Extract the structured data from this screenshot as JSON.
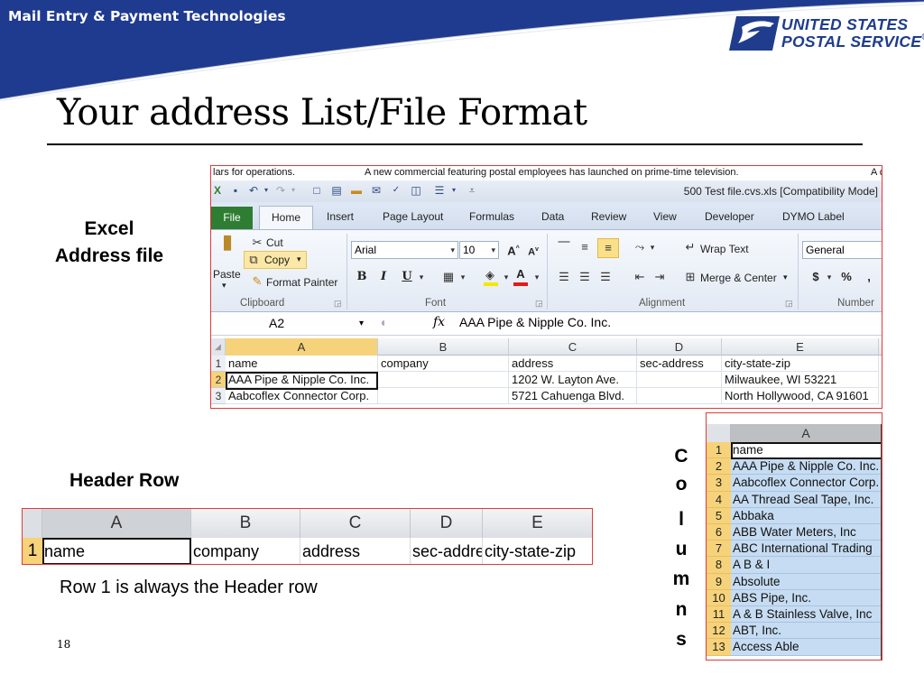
{
  "header": {
    "label": "Mail Entry & Payment Technologies",
    "logo_line1": "UNITED STATES",
    "logo_line2": "POSTAL SERVICE",
    "logo_mark": "®",
    "band_color": "#1f3b8f"
  },
  "slide": {
    "title": "Your address List/File Format",
    "page_number": "18"
  },
  "labels": {
    "excel_line1": "Excel",
    "excel_line2": "Address file",
    "header_row": "Header Row",
    "row1_caption": "Row 1 is always the Header row",
    "columns_letters": [
      "C",
      "o",
      "l",
      "u",
      "m",
      "n",
      "s"
    ]
  },
  "excel": {
    "ticker_left": "lars for operations.",
    "ticker_mid": "A new commercial featuring postal employees has launched on prime-time television.",
    "ticker_right": "A c",
    "window_title": "500 Test file.cvs.xls  [Compatibility Mode]",
    "tabs": [
      "File",
      "Home",
      "Insert",
      "Page Layout",
      "Formulas",
      "Data",
      "Review",
      "View",
      "Developer",
      "DYMO Label"
    ],
    "ribbon": {
      "paste": "Paste",
      "cut": "Cut",
      "copy": "Copy",
      "format_painter": "Format Painter",
      "font_name": "Arial",
      "font_size": "10",
      "wrap_text": "Wrap Text",
      "merge_center": "Merge & Center",
      "number_format": "General",
      "groups": [
        "Clipboard",
        "Font",
        "Alignment",
        "Number"
      ]
    },
    "name_box": "A2",
    "formula": "AAA Pipe & Nipple Co. Inc.",
    "columns": [
      "A",
      "B",
      "C",
      "D",
      "E"
    ],
    "rows": [
      {
        "num": "1",
        "cells": [
          "name",
          "company",
          "address",
          "sec-address",
          "city-state-zip"
        ]
      },
      {
        "num": "2",
        "cells": [
          "AAA Pipe & Nipple Co. Inc.",
          "",
          "1202 W. Layton Ave.",
          "",
          "Milwaukee, WI 53221"
        ]
      },
      {
        "num": "3",
        "cells": [
          "Aabcoflex Connector Corp.",
          "",
          "5721 Cahuenga Blvd.",
          "",
          "North Hollywood, CA 91601"
        ]
      }
    ]
  },
  "header_row_snippet": {
    "columns": [
      "A",
      "B",
      "C",
      "D",
      "E"
    ],
    "row_num": "1",
    "cells": [
      "name",
      "company",
      "address",
      "sec-address",
      "city-state-zip"
    ]
  },
  "column_a_snippet": {
    "header": "A",
    "rows": [
      {
        "num": "1",
        "value": "name"
      },
      {
        "num": "2",
        "value": "AAA Pipe & Nipple Co. Inc."
      },
      {
        "num": "3",
        "value": "Aabcoflex Connector Corp."
      },
      {
        "num": "4",
        "value": "AA Thread Seal Tape, Inc."
      },
      {
        "num": "5",
        "value": "Abbaka"
      },
      {
        "num": "6",
        "value": "ABB Water Meters, Inc"
      },
      {
        "num": "7",
        "value": "ABC International Trading"
      },
      {
        "num": "8",
        "value": "A B & I"
      },
      {
        "num": "9",
        "value": "Absolute"
      },
      {
        "num": "10",
        "value": "ABS Pipe, Inc."
      },
      {
        "num": "11",
        "value": "A & B Stainless Valve, Inc"
      },
      {
        "num": "12",
        "value": "ABT, Inc."
      },
      {
        "num": "13",
        "value": "Access Able"
      }
    ]
  }
}
